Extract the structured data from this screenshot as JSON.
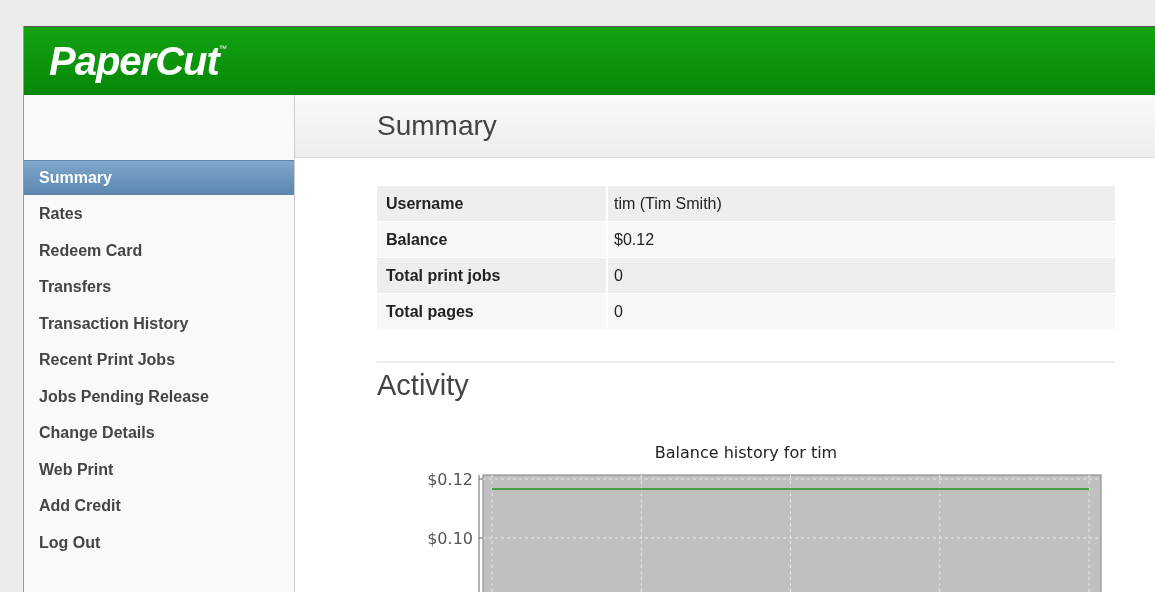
{
  "header": {
    "logo": "PaperCut",
    "trademark": "™"
  },
  "sidebar": {
    "items": [
      {
        "label": "Summary",
        "selected": true
      },
      {
        "label": "Rates",
        "selected": false
      },
      {
        "label": "Redeem Card",
        "selected": false
      },
      {
        "label": "Transfers",
        "selected": false
      },
      {
        "label": "Transaction History",
        "selected": false
      },
      {
        "label": "Recent Print Jobs",
        "selected": false
      },
      {
        "label": "Jobs Pending Release",
        "selected": false
      },
      {
        "label": "Change Details",
        "selected": false
      },
      {
        "label": "Web Print",
        "selected": false
      },
      {
        "label": "Add Credit",
        "selected": false
      },
      {
        "label": "Log Out",
        "selected": false
      }
    ]
  },
  "page_title": "Summary",
  "summary_table": {
    "rows": [
      {
        "label": "Username",
        "value": "tim (Tim Smith)"
      },
      {
        "label": "Balance",
        "value": "$0.12"
      },
      {
        "label": "Total print jobs",
        "value": "0"
      },
      {
        "label": "Total pages",
        "value": "0"
      }
    ]
  },
  "activity": {
    "heading": "Activity",
    "chart_data": {
      "type": "line",
      "title": "Balance history for tim",
      "grid": true,
      "ylim": [
        0.08,
        0.12
      ],
      "yticks": [
        {
          "value": 0.12,
          "label": "$0.12"
        },
        {
          "value": 0.1,
          "label": "$0.10"
        }
      ],
      "series": [
        {
          "color": "#1a9a1a",
          "values": [
            0.1166,
            0.1166,
            0.1166,
            0.1166,
            0.1166
          ]
        }
      ]
    }
  }
}
